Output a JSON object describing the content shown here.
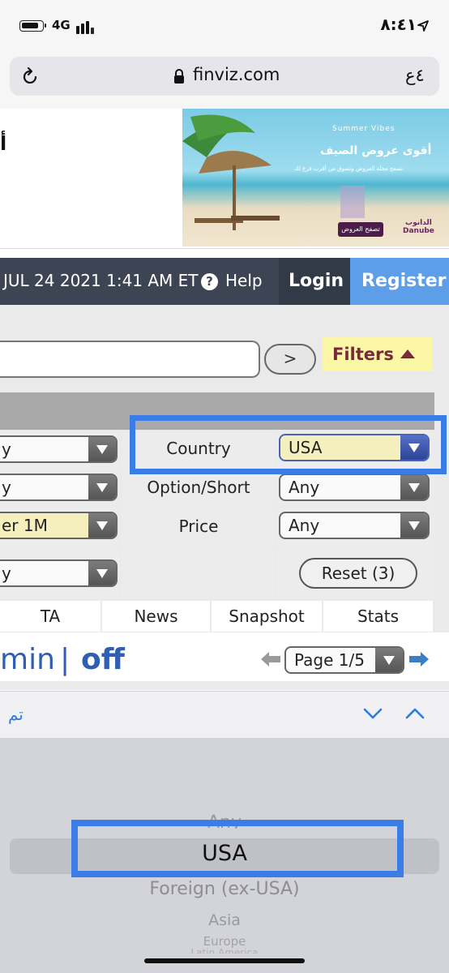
{
  "status_bar": {
    "network": "4G",
    "time": "٨:٤١"
  },
  "browser": {
    "url": "finviz.com",
    "text_size_label": "٤ع"
  },
  "ad": {
    "left_glyph": "أ",
    "tagline": "Summer Vibes",
    "title": "أقوى عروض الصيف",
    "subtitle": "تصفح مجلة العروض وتسوق من أقرب فرع لك",
    "cta": "تصفح العروض",
    "brand_ar": "الدانوب",
    "brand_en": "Danube"
  },
  "nav": {
    "datetime": "JUL 24 2021 1:41 AM ET",
    "help": "Help",
    "login": "Login",
    "register": "Register"
  },
  "screener": {
    "go_label": ">",
    "filters_label": "Filters",
    "rows": [
      {
        "left_value": "y",
        "label": "Country",
        "right_value": "USA"
      },
      {
        "left_value": "y",
        "label": "Option/Short",
        "right_value": "Any"
      },
      {
        "left_value": "er 1M",
        "label": "Price",
        "right_value": "Any"
      },
      {
        "left_value": "y",
        "label": "",
        "right_value": ""
      }
    ],
    "reset_label": "Reset (3)",
    "tabs": [
      "TA",
      "News",
      "Snapshot",
      "Stats"
    ],
    "view_label": "min",
    "view_separator": "|",
    "view_off": "off",
    "page_label": "Page 1/5"
  },
  "keyboard": {
    "done_label": "تم"
  },
  "picker": {
    "options": [
      "Any",
      "USA",
      "Foreign (ex-USA)",
      "Asia",
      "Europe",
      "Latin America"
    ],
    "selected": "USA"
  },
  "colors": {
    "nav_bg": "#3d4554",
    "register_bg": "#5d9ee8",
    "highlight": "#3a7de6",
    "filters_bg": "#fbf7a6",
    "link_blue": "#2f5fb3"
  }
}
